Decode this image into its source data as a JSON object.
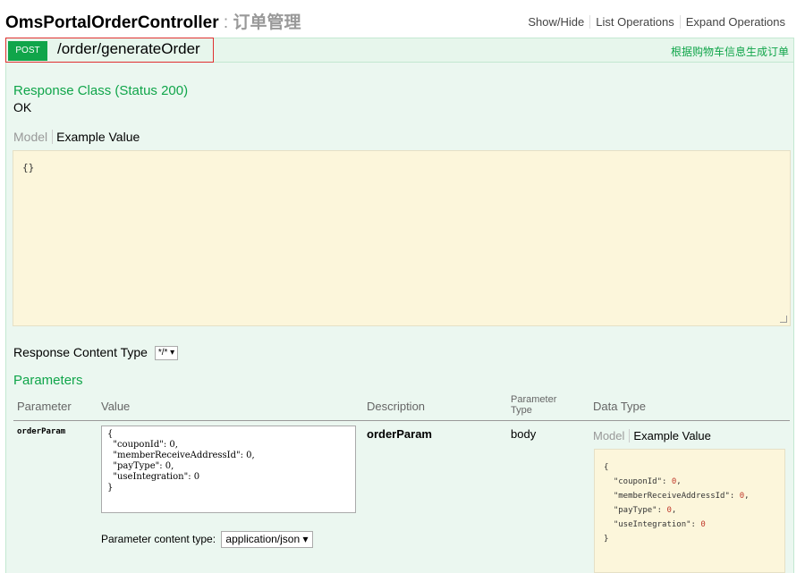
{
  "controller": {
    "name": "OmsPortalOrderController",
    "separator": " : ",
    "description": "订单管理"
  },
  "ops": {
    "show_hide": "Show/Hide",
    "list_operations": "List Operations",
    "expand_operations": "Expand Operations"
  },
  "operation": {
    "method": "POST",
    "path": "/order/generateOrder",
    "summary": "根据购物车信息生成订单"
  },
  "response": {
    "class_label": "Response Class (Status 200)",
    "class_value": "OK",
    "tab_model": "Model",
    "tab_example": "Example Value",
    "example_value": "{}",
    "content_type_label": "Response Content Type",
    "content_type_value": "*/* ▾"
  },
  "parameters": {
    "title": "Parameters",
    "headers": {
      "parameter": "Parameter",
      "value": "Value",
      "description": "Description",
      "parameter_type_line1": "Parameter",
      "parameter_type_line2": "Type",
      "data_type": "Data Type"
    },
    "row": {
      "name": "orderParam",
      "value": "{\n  \"couponId\": 0,\n  \"memberReceiveAddressId\": 0,\n  \"payType\": 0,\n  \"useIntegration\": 0\n}",
      "description": "orderParam",
      "parameter_type": "body",
      "tab_model": "Model",
      "tab_example": "Example Value",
      "content_type_label": "Parameter content type:",
      "content_type_value": "application/json ▾"
    }
  },
  "colors": {
    "post_green": "#10a54a",
    "op_background": "#ebf7f0",
    "example_background": "#fcf6db",
    "highlight_red": "#e03030"
  }
}
